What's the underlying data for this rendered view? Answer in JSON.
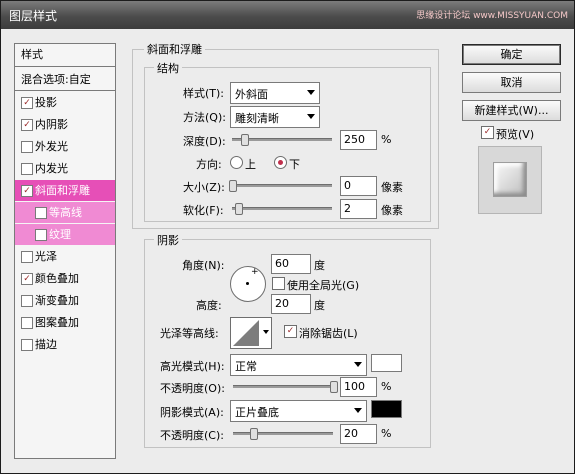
{
  "window": {
    "title": "图层样式",
    "watermark": "思缘设计论坛 www.MISSYUAN.COM"
  },
  "left_panel": {
    "header": "样式",
    "blend_options": "混合选项:自定",
    "items": [
      {
        "label": "投影",
        "checked": true
      },
      {
        "label": "内阴影",
        "checked": true
      },
      {
        "label": "外发光",
        "checked": false
      },
      {
        "label": "内发光",
        "checked": false
      },
      {
        "label": "斜面和浮雕",
        "checked": true
      },
      {
        "label": "等高线",
        "checked": false
      },
      {
        "label": "纹理",
        "checked": false
      },
      {
        "label": "光泽",
        "checked": false
      },
      {
        "label": "颜色叠加",
        "checked": true
      },
      {
        "label": "渐变叠加",
        "checked": false
      },
      {
        "label": "图案叠加",
        "checked": false
      },
      {
        "label": "描边",
        "checked": false
      }
    ]
  },
  "bevel": {
    "title": "斜面和浮雕",
    "structure_title": "结构",
    "style_label": "样式(T):",
    "style_value": "外斜面",
    "technique_label": "方法(Q):",
    "technique_value": "雕刻清晰",
    "depth_label": "深度(D):",
    "depth_value": "250",
    "depth_level": 0.12,
    "depth_unit": "%",
    "direction_label": "方向:",
    "dir_up": "上",
    "dir_down": "下",
    "direction": "下",
    "size_label": "大小(Z):",
    "size_value": "0",
    "size_level": 0.0,
    "size_unit": "像素",
    "soften_label": "软化(F):",
    "soften_value": "2",
    "soften_level": 0.06,
    "soften_unit": "像素"
  },
  "shading": {
    "title": "阴影",
    "angle_label": "角度(N):",
    "angle_value": "60",
    "angle_unit": "度",
    "global_light_label": "使用全局光(G)",
    "global_light": false,
    "altitude_label": "高度:",
    "altitude_value": "20",
    "altitude_unit": "度",
    "gloss_label": "光泽等高线:",
    "antialias_label": "消除锯齿(L)",
    "antialias": true,
    "highlight_mode_label": "高光模式(H):",
    "highlight_mode": "正常",
    "highlight_color": "#ffffff",
    "opacity1_label": "不透明度(O):",
    "opacity1_value": "100",
    "opacity1_level": 1.0,
    "opacity_unit": "%",
    "shadow_mode_label": "阴影模式(A):",
    "shadow_mode": "正片叠底",
    "shadow_color": "#000000",
    "opacity2_label": "不透明度(C):",
    "opacity2_value": "20",
    "opacity2_level": 0.2
  },
  "buttons": {
    "ok": "确定",
    "cancel": "取消",
    "new_style": "新建样式(W)...",
    "preview_label": "预览(V)",
    "preview": true
  },
  "colors": {
    "selected": "#e64fb7",
    "sub": "#f08ad3",
    "check": "#9a2b2b",
    "radio": "#c0304c"
  }
}
